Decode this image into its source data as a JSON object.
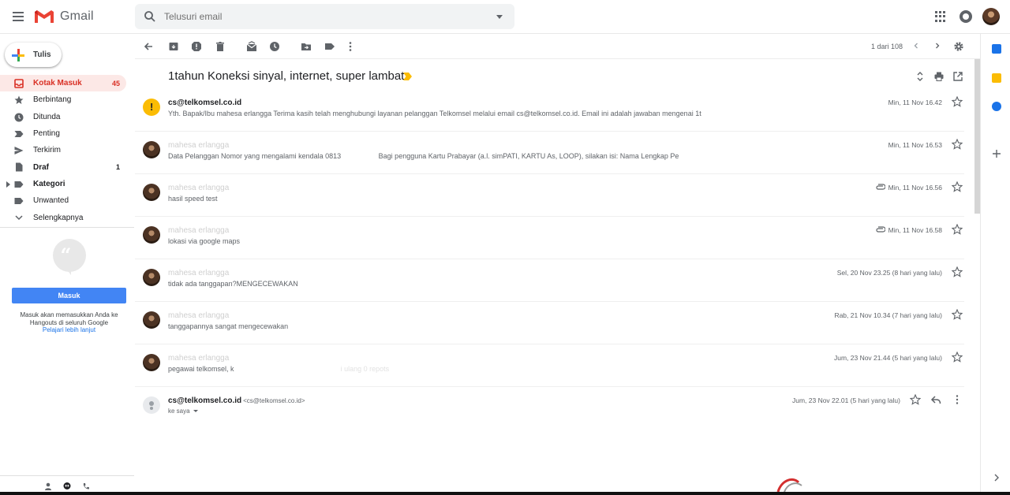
{
  "app": {
    "brand": "Gmail",
    "search_placeholder": "Telusuri email"
  },
  "sidebar": {
    "compose_label": "Tulis",
    "items": [
      {
        "label": "Kotak Masuk",
        "count": "45",
        "icon": "inbox-icon",
        "active": true
      },
      {
        "label": "Berbintang",
        "count": "",
        "icon": "star-icon"
      },
      {
        "label": "Ditunda",
        "count": "",
        "icon": "clock-icon"
      },
      {
        "label": "Penting",
        "count": "",
        "icon": "important-icon"
      },
      {
        "label": "Terkirim",
        "count": "",
        "icon": "send-icon"
      },
      {
        "label": "Draf",
        "count": "1",
        "icon": "draft-icon",
        "bold": true
      },
      {
        "label": "Kategori",
        "count": "",
        "icon": "label-icon",
        "bold": true
      },
      {
        "label": "Unwanted",
        "count": "",
        "icon": "label-icon"
      },
      {
        "label": "Selengkapnya",
        "count": "",
        "icon": "chevron-down-icon"
      }
    ],
    "hangouts": {
      "signin_label": "Masuk",
      "text": "Masuk akan memasukkan Anda ke Hangouts di seluruh Google",
      "link": "Pelajari lebih lanjut"
    }
  },
  "toolbar": {
    "pager": "1 dari 108"
  },
  "thread": {
    "subject": "1tahun Koneksi sinyal, internet, super lambat",
    "messages": [
      {
        "from": "cs@telkomsel.co.id",
        "snippet": "Yth. Bapak/Ibu mahesa erlangga Terima kasih telah menghubungi layanan pelanggan Telkomsel melalui email cs@telkomsel.co.id. Email ini adalah jawaban mengenai 1t",
        "date": "Min, 11 Nov 16.42",
        "attachment": false
      },
      {
        "from": "mahesa erlangga",
        "snippet": "Data Pelanggan Nomor yang mengalami kendala 0813",
        "snippet_tail": "Bagi pengguna Kartu Prabayar (a.l. simPATI, KARTU As, LOOP), silakan isi: Nama Lengkap Pe",
        "date": "Min, 11 Nov 16.53",
        "attachment": false
      },
      {
        "from": "mahesa erlangga",
        "snippet": "hasil speed test",
        "date": "Min, 11 Nov 16.56",
        "attachment": true
      },
      {
        "from": "mahesa erlangga",
        "snippet": "lokasi via google maps",
        "date": "Min, 11 Nov 16.58",
        "attachment": true
      },
      {
        "from": "mahesa erlangga",
        "snippet": "tidak ada tanggapan?MENGECEWAKAN",
        "date": "Sel, 20 Nov 23.25 (8 hari yang lalu)",
        "attachment": false
      },
      {
        "from": "mahesa erlangga",
        "snippet": "tanggapannya sangat mengecewakan",
        "date": "Rab, 21 Nov 10.34 (7 hari yang lalu)",
        "attachment": false
      },
      {
        "from": "mahesa erlangga",
        "snippet": "pegawai telkomsel, k",
        "snippet_tail": "i ulang 0 repots",
        "date": "Jum, 23 Nov 21.44 (5 hari yang lalu)",
        "attachment": false
      }
    ],
    "open_message": {
      "from": "cs@telkomsel.co.id",
      "email": "<cs@telkomsel.co.id>",
      "to": "ke saya",
      "date": "Jum, 23 Nov 22.01 (5 hari yang lalu)"
    }
  },
  "colors": {
    "accent_red": "#d93025",
    "active_bg": "#fce8e6",
    "signin_blue": "#4285f4",
    "label_yellow": "#fbbc04"
  }
}
